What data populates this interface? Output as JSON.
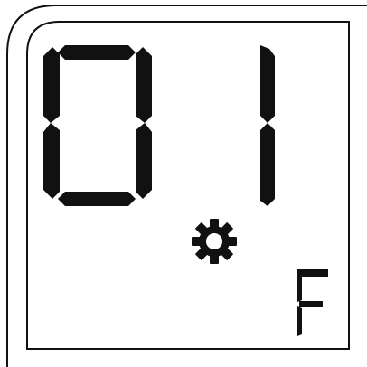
{
  "display": {
    "digits": [
      "0",
      "1"
    ],
    "mode_icon": "gear-icon",
    "unit_letter": "F",
    "colors": {
      "background": "#ffffff",
      "segment": "#111111",
      "frame": "#111111"
    }
  }
}
